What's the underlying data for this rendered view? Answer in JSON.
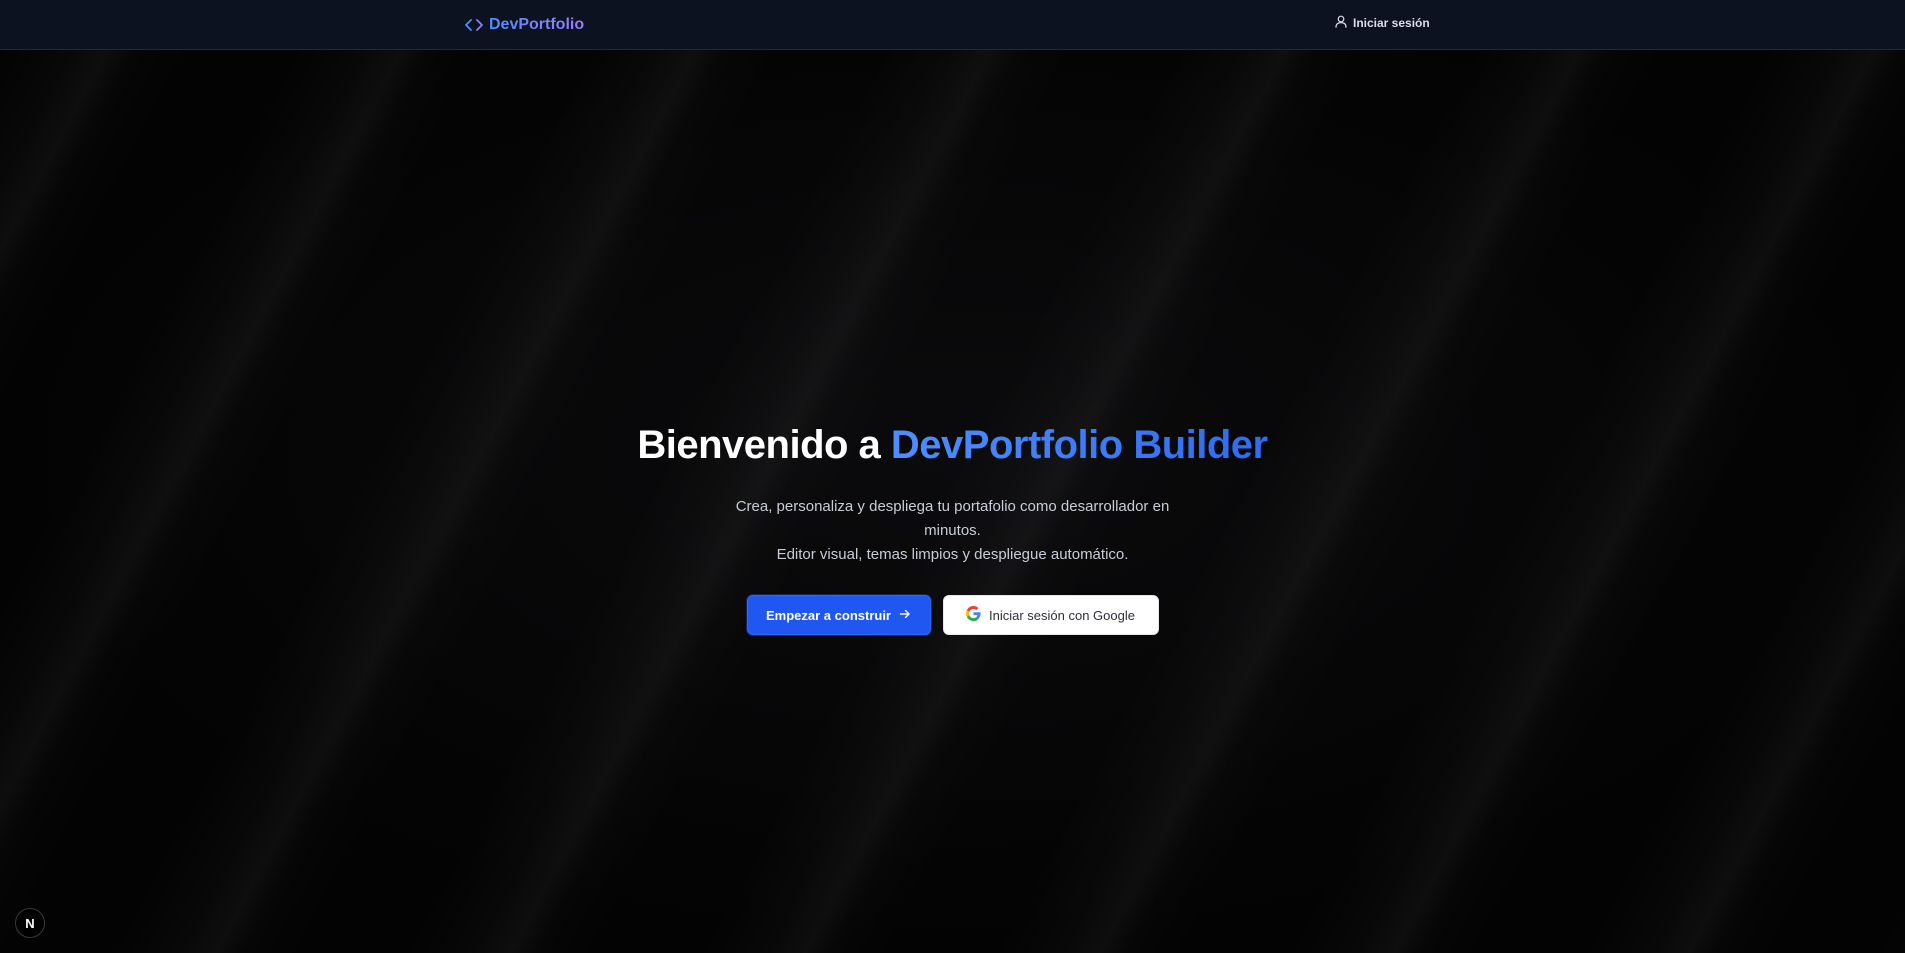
{
  "navbar": {
    "brand": "DevPortfolio",
    "brand_icon": "code-brackets-icon",
    "login_label": "Iniciar sesión",
    "login_icon": "user-icon"
  },
  "hero": {
    "title_prefix": "Bienvenido a ",
    "title_accent": "DevPortfolio Builder",
    "subtitle_line1": "Crea, personaliza y despliega tu portafolio como desarrollador en minutos.",
    "subtitle_line2": "Editor visual, temas limpios y despliegue automático."
  },
  "actions": {
    "primary_label": "Empezar a construir",
    "primary_icon": "arrow-right-icon",
    "google_label": "Iniciar sesión con Google",
    "google_icon": "google-icon"
  },
  "dev_badge": {
    "letter": "N",
    "icon": "nextjs-icon"
  },
  "colors": {
    "navbar_bg": "#0d1220",
    "accent_blue": "#1f57f0",
    "brand_gradient_start": "#4f8dff",
    "brand_gradient_end": "#9b7bff"
  }
}
